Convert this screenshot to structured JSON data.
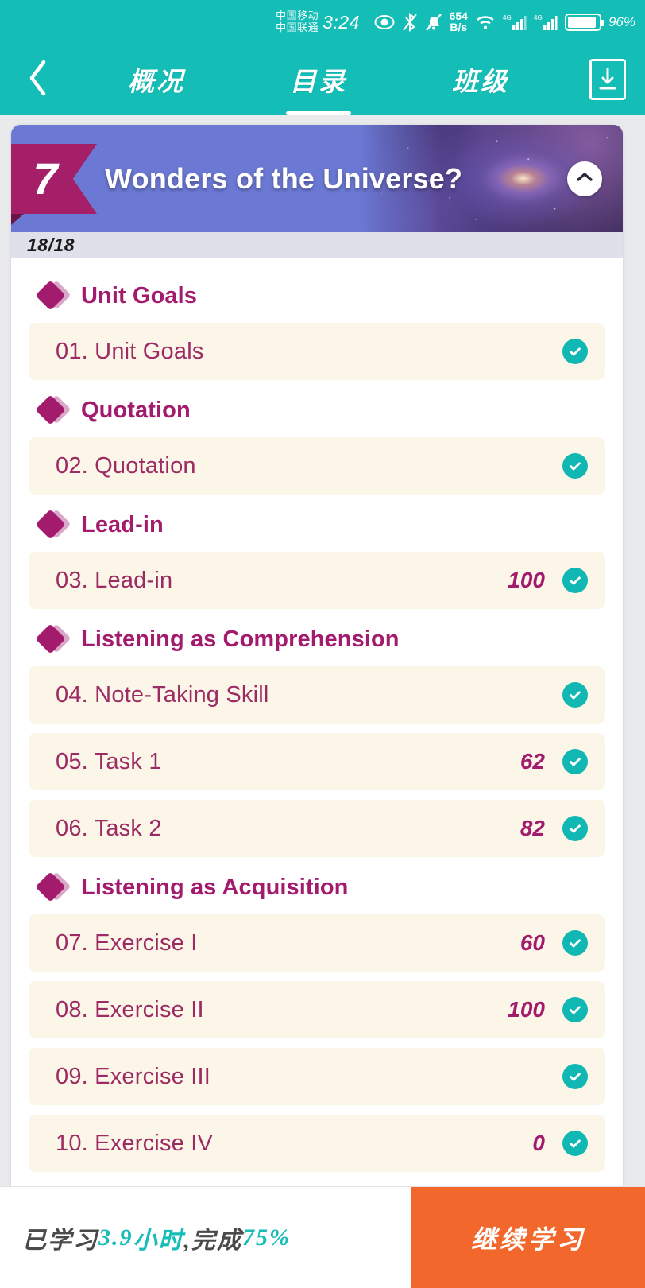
{
  "status_bar": {
    "carrier_1": "中国移动",
    "carrier_2": "中国联通",
    "time": "3:24",
    "net_speed_value": "654",
    "net_speed_unit": "B/s",
    "battery_percent": "96%",
    "signal_1_label": "4G",
    "signal_2_label": "4G",
    "icons": [
      "eye-care-icon",
      "bluetooth-off-icon",
      "bell-muted-icon",
      "wifi-icon",
      "signal-icon",
      "battery-icon"
    ]
  },
  "nav": {
    "back_icon": "chevron-left-icon",
    "download_icon": "download-icon",
    "tabs": [
      {
        "label": "概况",
        "active": false
      },
      {
        "label": "目录",
        "active": true
      },
      {
        "label": "班级",
        "active": false
      }
    ]
  },
  "unit_header": {
    "number": "7",
    "title": "Wonders of the Universe?",
    "progress": "18/18",
    "collapse_icon": "chevron-up-icon"
  },
  "sections": [
    {
      "title": "Unit Goals",
      "items": [
        {
          "label": "01. Unit Goals",
          "score": "",
          "completed": true
        }
      ]
    },
    {
      "title": "Quotation",
      "items": [
        {
          "label": "02. Quotation",
          "score": "",
          "completed": true
        }
      ]
    },
    {
      "title": "Lead-in",
      "items": [
        {
          "label": "03. Lead-in",
          "score": "100",
          "completed": true
        }
      ]
    },
    {
      "title": "Listening as Comprehension",
      "items": [
        {
          "label": "04. Note-Taking Skill",
          "score": "",
          "completed": true
        },
        {
          "label": "05. Task 1",
          "score": "62",
          "completed": true
        },
        {
          "label": "06. Task 2",
          "score": "82",
          "completed": true
        }
      ]
    },
    {
      "title": "Listening as Acquisition",
      "items": [
        {
          "label": "07. Exercise I",
          "score": "60",
          "completed": true
        },
        {
          "label": "08. Exercise II",
          "score": "100",
          "completed": true
        },
        {
          "label": "09. Exercise III",
          "score": "",
          "completed": true
        },
        {
          "label": "10. Exercise IV",
          "score": "0",
          "completed": true
        }
      ]
    }
  ],
  "bottom_bar": {
    "stat_prefix": "已学习",
    "stat_hours": "3.9",
    "stat_hours_unit": "小时",
    "stat_middle": ",完成",
    "stat_percent": "75%",
    "cta_label": "继续学习"
  },
  "colors": {
    "teal": "#14bdb6",
    "magenta": "#a31b6d",
    "orange": "#f2682c",
    "hero_purple": "#6b79d4",
    "row_cream": "#fcf6e9",
    "check_teal": "#11b8b3"
  }
}
